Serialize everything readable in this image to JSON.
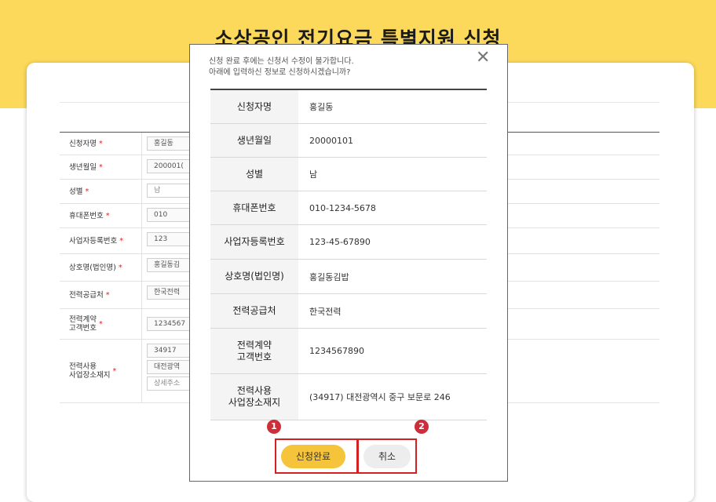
{
  "page": {
    "title": "소상공인 전기요금 특별지원 신청"
  },
  "form": {
    "rows": [
      {
        "label": "신청자명",
        "required": "*",
        "values": [
          "홍길동"
        ]
      },
      {
        "label": "생년월일",
        "required": "*",
        "values": [
          "200001("
        ]
      },
      {
        "label": "성별",
        "required": "*",
        "values": [
          "남"
        ]
      },
      {
        "label": "휴대폰번호",
        "required": "*",
        "values": [
          "010"
        ]
      },
      {
        "label": "사업자등록번호",
        "required": "*",
        "values": [
          "123"
        ]
      },
      {
        "label": "상호명(법인명)",
        "required": "*",
        "values": [
          "홍길동김"
        ]
      },
      {
        "label": "전력공급처",
        "required": "*",
        "values": [
          "한국전력"
        ]
      },
      {
        "label": "전력계약\n고객번호",
        "required": "*",
        "values": [
          "1234567"
        ]
      },
      {
        "label": "전력사용\n사업장소재지",
        "required": "*",
        "values": [
          "34917",
          "대전광역",
          "상세주소"
        ]
      }
    ]
  },
  "modal": {
    "notice_line1": "신청 완료 후에는 신청서 수정이 불가합니다.",
    "notice_line2": "아래에 입력하신 정보로 신청하시겠습니까?",
    "close_glyph": "✕",
    "rows": [
      {
        "label_1": "신청자명",
        "label_2": "",
        "value": "홍길동"
      },
      {
        "label_1": "생년월일",
        "label_2": "",
        "value": "20000101"
      },
      {
        "label_1": "성별",
        "label_2": "",
        "value": "남"
      },
      {
        "label_1": "휴대폰번호",
        "label_2": "",
        "value": "010-1234-5678"
      },
      {
        "label_1": "사업자등록번호",
        "label_2": "",
        "value": "123-45-67890"
      },
      {
        "label_1": "상호명(법인명)",
        "label_2": "",
        "value": "홍길동김밥"
      },
      {
        "label_1": "전력공급처",
        "label_2": "",
        "value": "한국전력"
      },
      {
        "label_1": "전력계약",
        "label_2": "고객번호",
        "value": "1234567890"
      },
      {
        "label_1": "전력사용",
        "label_2": "사업장소재지",
        "value": "(34917) 대전광역시 중구 보문로 246"
      }
    ],
    "step1": "1",
    "step2": "2",
    "confirm_label": "신청완료",
    "cancel_label": "취소"
  },
  "colors": {
    "band": "#fcd95a",
    "confirm": "#f6c43b",
    "step_badge": "#cc2f3a",
    "highlight": "#d42020",
    "required_star": "#e02020"
  }
}
